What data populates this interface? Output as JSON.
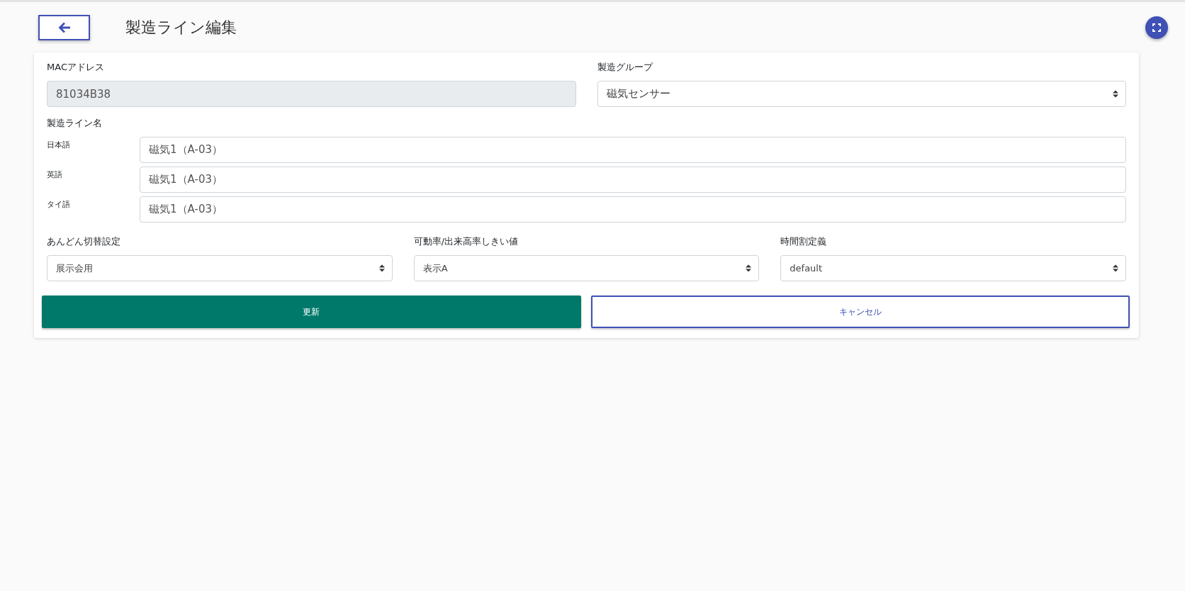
{
  "header": {
    "title": "製造ライン編集"
  },
  "mac": {
    "label": "MACアドレス",
    "value": "81034B38",
    "disabled": true
  },
  "group": {
    "label": "製造グループ",
    "value": "磁気センサー"
  },
  "line_name": {
    "label": "製造ライン名",
    "fields": [
      {
        "label": "日本語",
        "value": "磁気1（A-03）"
      },
      {
        "label": "英語",
        "value": "磁気1（A-03）"
      },
      {
        "label": "タイ語",
        "value": "磁気1（A-03）"
      }
    ]
  },
  "selects": [
    {
      "label": "あんどん切替設定",
      "value": "展示会用"
    },
    {
      "label": "可動率/出来高率しきい値",
      "value": "表示A"
    },
    {
      "label": "時間割定義",
      "value": "default"
    }
  ],
  "buttons": [
    {
      "label": "更新",
      "kind": "primary"
    },
    {
      "label": "キャンセル",
      "kind": "outline"
    }
  ]
}
